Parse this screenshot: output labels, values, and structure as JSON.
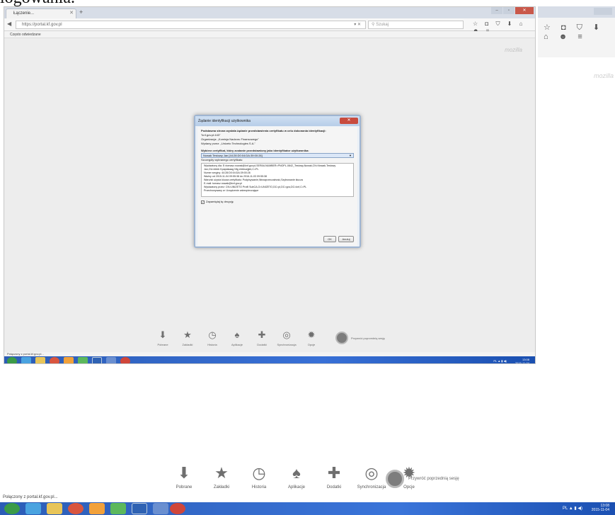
{
  "page": {
    "heading_fragment": "logowania."
  },
  "browser": {
    "tab_title": "Łączenie...",
    "url": "https://portal.kf.gov.pl",
    "search_placeholder": "Szukaj",
    "bookmarks_label": "Często odwiedzane",
    "mozilla_mark": "mozilla",
    "toolbar_icons": "☆ ◘ ⛉ ⬇ ⌂ ☻ ≡",
    "status_text": "Połączony z portal.kf.gov.pl..."
  },
  "dialog": {
    "title": "Żądanie identyfikacji użytkownika",
    "close_label": "Zamknij",
    "intro": "Podstawna strona wysłała żądanie przedstawienia certyfikatu w celu dokonania identyfikacji:",
    "site": "\"knf.gov.pl:443\"",
    "organization": "Organizacja: „Komisja Nadzoru Finansowego\"",
    "issuer": "Wydany przez: „Unizeto Technologies S.A.\"",
    "choose_label": "Wybierz certyfikat, który zostanie przedstawiony jako identyfikator użytkownika:",
    "selected_cert": "Nowak Testowy Jan [44:28:D0:04:DA:39:00:26]",
    "details_label": "Szczegóły wybranego certyfikatu:",
    "details": [
      "Wystawiony dla: E=tomasz.nowak@knf.gov.pl,SERIALNUMBER=PNOPL-0842_Testowy,Nowak,CN=Nowak-Testowy",
      "Jan,OU=bbbb Kpapiakaag Nfg ebbbuejjeb,C=PL",
      "Numer seryjny: 44:28:D0:04:DA:39:00:26",
      "Ważny od 2015-11-04 09:55:38 do 2016-11-03 09:55:38",
      "Warunki użycia klucza certyfikatu: Podpisywanie,Niezaprzeczalność,Szyfrowanie klucza",
      "E-mail: tomasz.nowak@knf.gov.pl",
      "Wystawiony przez: CN=UNIZETO Profil SubCA,O=UNIZETO,DC=pl,DC=gov,DC=knf,C=PL",
      "Przechowywany w: Urządzenie zabezpieczające"
    ],
    "remember_label": "Zapamiętaj tę decyzję",
    "ok_label": "OK",
    "cancel_label": "Anuluj"
  },
  "newtab_tiles": [
    {
      "icon": "download-icon",
      "glyph": "⬇",
      "label": "Pobrane"
    },
    {
      "icon": "bookmarks-icon",
      "glyph": "★",
      "label": "Zakładki"
    },
    {
      "icon": "history-icon",
      "glyph": "◷",
      "label": "Historia"
    },
    {
      "icon": "addons-icon",
      "glyph": "♠",
      "label": "Aplikacje"
    },
    {
      "icon": "plugins-icon",
      "glyph": "✚",
      "label": "Dodatki"
    },
    {
      "icon": "sync-icon",
      "glyph": "◎",
      "label": "Synchronizacja"
    },
    {
      "icon": "options-icon",
      "glyph": "✹",
      "label": "Opcje"
    }
  ],
  "restore_session_label": "Przywróć poprzednią sesję",
  "taskbar": {
    "clock_time": "13:08",
    "clock_date": "2015-11-04",
    "tray_text": "PL ▲ ▮ ◀)"
  },
  "colors": {
    "taskbar": "#2c5db7",
    "dialog_close": "#c84b3e",
    "content_bg": "#ededed"
  }
}
